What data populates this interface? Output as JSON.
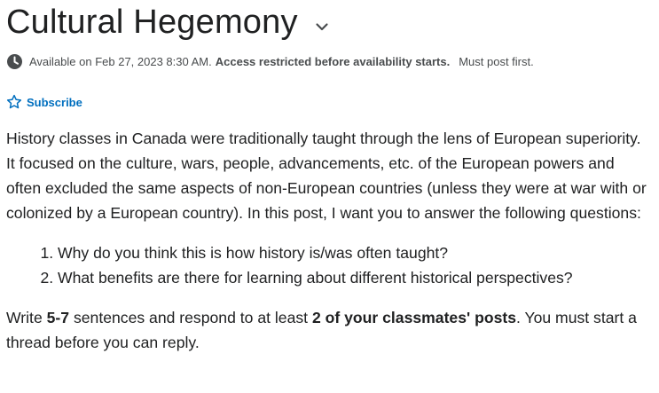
{
  "topic": {
    "title": "Cultural Hegemony",
    "chevron_icon": "chevron-down-icon"
  },
  "availability": {
    "icon": "clock-icon",
    "text": "Available on Feb 27, 2023 8:30 AM.",
    "restriction": "Access restricted before availability starts.",
    "must_post": "Must post first."
  },
  "subscribe": {
    "icon": "star-outline-icon",
    "label": "Subscribe",
    "color": "#006fbf"
  },
  "description": {
    "intro": "History classes in Canada were traditionally taught through the lens of European superiority. It focused on the culture, wars, people, advancements, etc. of the European powers and often excluded the same aspects of non-European countries (unless they were at war with or colonized by a European country). In this post, I want you to answer the following questions:",
    "questions": [
      "Why do you think this is how history is/was often taught?",
      "What benefits are there for learning about different historical perspectives?"
    ],
    "instructions": {
      "part1": "Write ",
      "sentences": "5-7",
      "part2": " sentences and respond to at least ",
      "classmates": "2 of your classmates' posts",
      "part3": ". You must start a thread before you can reply."
    }
  }
}
